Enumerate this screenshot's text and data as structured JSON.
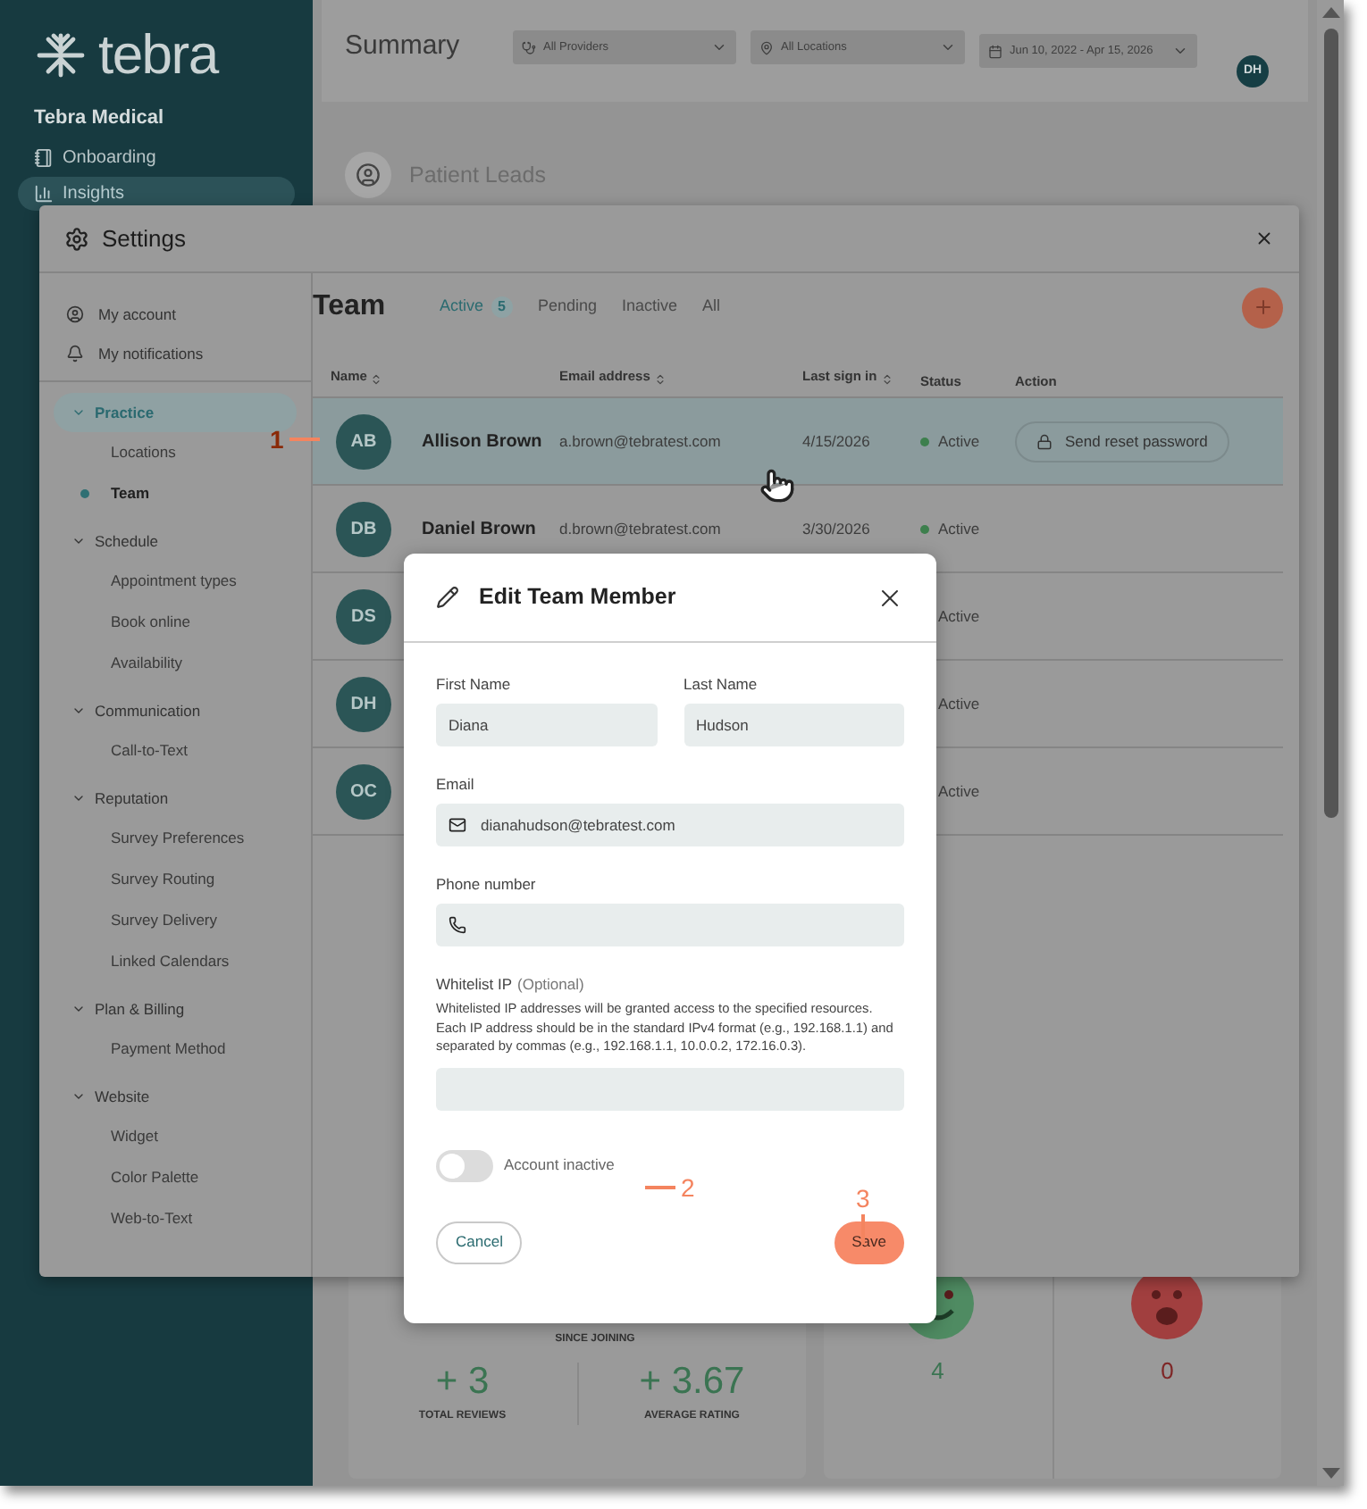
{
  "app": {
    "logo": "tebra",
    "practice": "Tebra Medical",
    "nav": [
      {
        "label": "Onboarding",
        "kind": "notebook",
        "selected": false
      },
      {
        "label": "Insights",
        "kind": "chart",
        "selected": true
      }
    ]
  },
  "header": {
    "title": "Summary",
    "filters": [
      {
        "label": "All Providers",
        "kind": "provider"
      },
      {
        "label": "All Locations",
        "kind": "location"
      },
      {
        "label": "Jun 10, 2022 - Apr 15, 2026",
        "kind": "date"
      }
    ],
    "avatar": "DH"
  },
  "patient_leads": {
    "title": "Patient Leads"
  },
  "review_summary": {
    "since_label": "SINCE JOINING",
    "stats": [
      {
        "value": "+ 3",
        "label": "TOTAL REVIEWS"
      },
      {
        "value": "+ 3.67",
        "label": "AVERAGE RATING"
      }
    ]
  },
  "sentiment": [
    {
      "kind": "happy",
      "count": "4"
    },
    {
      "kind": "sad",
      "count": "0"
    }
  ],
  "settings": {
    "title": "Settings",
    "account_items": [
      {
        "label": "My account",
        "kind": "account"
      },
      {
        "label": "My notifications",
        "kind": "notifications"
      }
    ],
    "sections": [
      {
        "label": "Practice",
        "expanded": true,
        "selected": true,
        "children": [
          {
            "label": "Locations",
            "selected": false
          },
          {
            "label": "Team",
            "selected": true
          }
        ]
      },
      {
        "label": "Schedule",
        "expanded": true,
        "selected": false,
        "children": [
          {
            "label": "Appointment types",
            "selected": false
          },
          {
            "label": "Book online",
            "selected": false
          },
          {
            "label": "Availability",
            "selected": false
          }
        ]
      },
      {
        "label": "Communication",
        "expanded": true,
        "selected": false,
        "children": [
          {
            "label": "Call-to-Text",
            "selected": false
          }
        ]
      },
      {
        "label": "Reputation",
        "expanded": true,
        "selected": false,
        "children": [
          {
            "label": "Survey Preferences",
            "selected": false
          },
          {
            "label": "Survey Routing",
            "selected": false
          },
          {
            "label": "Survey Delivery",
            "selected": false
          },
          {
            "label": "Linked Calendars",
            "selected": false
          }
        ]
      },
      {
        "label": "Plan & Billing",
        "expanded": true,
        "selected": false,
        "children": [
          {
            "label": "Payment Method",
            "selected": false
          }
        ]
      },
      {
        "label": "Website",
        "expanded": true,
        "selected": false,
        "children": [
          {
            "label": "Widget",
            "selected": false
          },
          {
            "label": "Color Palette",
            "selected": false
          },
          {
            "label": "Web-to-Text",
            "selected": false
          }
        ]
      }
    ]
  },
  "team": {
    "title": "Team",
    "tabs": [
      {
        "label": "Active",
        "count": "5",
        "selected": true
      },
      {
        "label": "Pending",
        "selected": false
      },
      {
        "label": "Inactive",
        "selected": false
      },
      {
        "label": "All",
        "selected": false
      }
    ],
    "columns": [
      {
        "label": "Name",
        "sortable": true
      },
      {
        "label": "Email address",
        "sortable": true
      },
      {
        "label": "Last sign in",
        "sortable": true
      },
      {
        "label": "Status",
        "sortable": false
      },
      {
        "label": "Action",
        "sortable": false
      }
    ],
    "rows": [
      {
        "initials": "AB",
        "name": "Allison Brown",
        "email": "a.brown@tebratest.com",
        "last_sign_in": "4/15/2026",
        "status": "Active",
        "action": "Send reset password",
        "selected": true
      },
      {
        "initials": "DB",
        "name": "Daniel Brown",
        "email": "d.brown@tebratest.com",
        "last_sign_in": "3/30/2026",
        "status": "Active",
        "selected": false
      },
      {
        "initials": "DS",
        "status": "Active",
        "selected": false
      },
      {
        "initials": "DH",
        "status": "Active",
        "selected": false
      },
      {
        "initials": "OC",
        "status": "Active",
        "selected": false
      }
    ]
  },
  "edit_member": {
    "title": "Edit Team Member",
    "name_fields": [
      {
        "label": "First Name",
        "value": "Diana"
      },
      {
        "label": "Last Name",
        "value": "Hudson"
      }
    ],
    "fields": [
      {
        "label": "Email",
        "kind": "email",
        "value": "dianahudson@tebratest.com"
      },
      {
        "label": "Phone number",
        "kind": "phone"
      },
      {
        "label": "Whitelist IP",
        "optional": "(Optional)",
        "help": "Whitelisted IP addresses will be granted access to the specified resources. Each IP address should be in the standard IPv4 format (e.g., 192.168.1.1) and separated by commas (e.g., 192.168.1.1, 10.0.0.2, 172.16.0.3).",
        "kind": "plain"
      }
    ],
    "inactive_toggle": {
      "label": "Account inactive",
      "on": false
    },
    "cancel": "Cancel",
    "save": "Save"
  },
  "annotations": [
    {
      "label": "1",
      "kind": "line_after"
    },
    {
      "label": "2",
      "kind": "line_before"
    },
    {
      "label": "3",
      "kind": "line_below"
    }
  ]
}
